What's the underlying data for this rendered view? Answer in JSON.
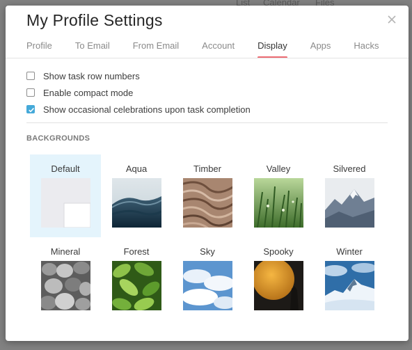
{
  "background_app": {
    "top_links": [
      "List",
      "Calendar",
      "Files"
    ]
  },
  "modal": {
    "title": "My Profile Settings",
    "close_label": "×"
  },
  "tabs": [
    {
      "label": "Profile",
      "active": false
    },
    {
      "label": "To Email",
      "active": false
    },
    {
      "label": "From Email",
      "active": false
    },
    {
      "label": "Account",
      "active": false
    },
    {
      "label": "Display",
      "active": true
    },
    {
      "label": "Apps",
      "active": false
    },
    {
      "label": "Hacks",
      "active": false
    }
  ],
  "options": [
    {
      "label": "Show task row numbers",
      "checked": false
    },
    {
      "label": "Enable compact mode",
      "checked": false
    },
    {
      "label": "Show occasional celebrations upon task completion",
      "checked": true
    }
  ],
  "backgrounds": {
    "title": "BACKGROUNDS",
    "selected": "Default",
    "items": [
      {
        "label": "Default",
        "icon": "default-layout-icon"
      },
      {
        "label": "Aqua",
        "icon": "ocean-wave-image"
      },
      {
        "label": "Timber",
        "icon": "wood-grain-image"
      },
      {
        "label": "Valley",
        "icon": "grass-image"
      },
      {
        "label": "Silvered",
        "icon": "mountain-image"
      },
      {
        "label": "Mineral",
        "icon": "pebbles-image"
      },
      {
        "label": "Forest",
        "icon": "leaves-image"
      },
      {
        "label": "Sky",
        "icon": "clouds-image"
      },
      {
        "label": "Spooky",
        "icon": "moon-image"
      },
      {
        "label": "Winter",
        "icon": "snowy-peak-image"
      }
    ]
  },
  "colors": {
    "accent_tab": "#ec6b73",
    "checkbox_checked": "#45a9d9",
    "selected_tile_bg": "#e4f4fc"
  }
}
